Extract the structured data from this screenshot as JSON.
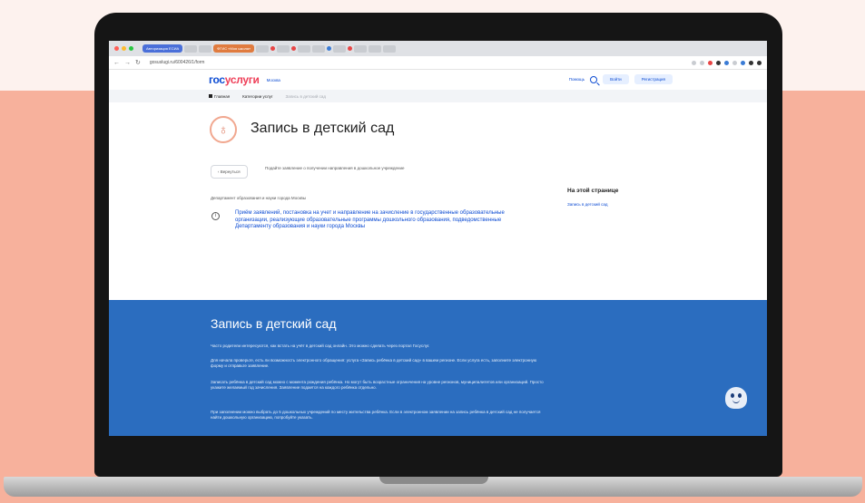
{
  "browser": {
    "tab_active_label": "Авторизация ЕСИА",
    "tab_second_label": "ФГИС «Моя школа»",
    "url": "gosuslugi.ru/600426/1/form"
  },
  "colors": {
    "brand_blue": "#0d4cd3",
    "brand_red": "#ee3f58",
    "section_blue": "#2b6dbf",
    "accent_orange": "#f1a78f"
  },
  "site": {
    "logo_main": "гос",
    "logo_accent": "услуги",
    "region": "Москва",
    "help_label": "Помощь",
    "search_icon": "search-icon",
    "login_label": "Войти",
    "register_label": "Регистрация"
  },
  "breadcrumbs": {
    "home_label": "Главная",
    "category_label": "Категории услуг",
    "current_label": "Запись в детский сад"
  },
  "main": {
    "title": "Запись в детский сад",
    "back_label": "Вернуться",
    "subtitle": "Подайте заявление о получении направления в дошкольное учреждение",
    "department": "Департамент образования и науки города Москвы",
    "notice": "Приём заявлений, постановка на учет и направление на зачисление в государственные образовательные организации, реализующие образовательные программы дошкольного образования, подведомственные Департаменту образования и науки города Москвы",
    "sidebar_title": "На этой странице",
    "sidebar_link": "Запись в детский сад"
  },
  "info_section": {
    "title": "Запись в детский сад",
    "p1": "Часто родители интересуются, как встать на учёт в детский сад онлайн. Это можно сделать через портал Госуслуг.",
    "p2": "Для начала проверьте, есть ли возможность электронного обращения: услуга «Запись ребёнка в детский сад» в вашем регионе. Если услуга есть, заполните электронную форму и отправьте заявление.",
    "p3": "Записать ребёнка в детский сад можно с момента рождения ребёнка. Но могут быть возрастные ограничения на уровне регионов, муниципалитетов или организаций. Просто укажите желаемый год зачисления. Заявление подается на каждого ребёнка отдельно.",
    "p4": "При заполнении можно выбрать до 5 дошкольных учреждений по месту жительства ребёнка. Если в электронном заявлении на запись ребёнка в детский сад не получается найти дошкольную организацию, попробуйте указать."
  }
}
